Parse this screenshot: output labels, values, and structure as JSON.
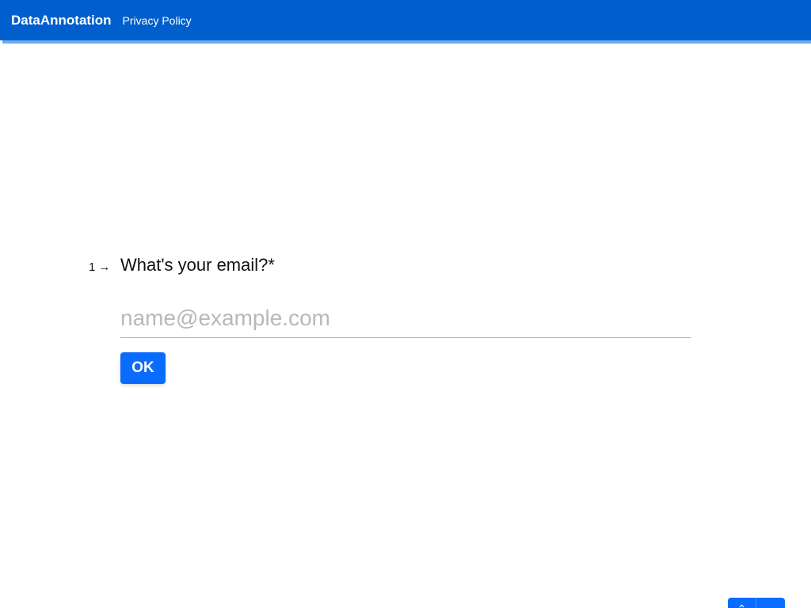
{
  "navbar": {
    "brand": "DataAnnotation",
    "links": [
      {
        "label": "Privacy Policy"
      }
    ],
    "color": "#005fcc"
  },
  "question": {
    "number": "1",
    "arrow_icon": "arrow-right-icon",
    "text": "What's your email?*"
  },
  "answer": {
    "placeholder": "name@example.com",
    "value": ""
  },
  "ok_button": {
    "label": "OK",
    "color": "#0a6cff"
  },
  "navigation": {
    "up_icon": "chevron-up-icon",
    "down_icon": "chevron-down-icon"
  }
}
